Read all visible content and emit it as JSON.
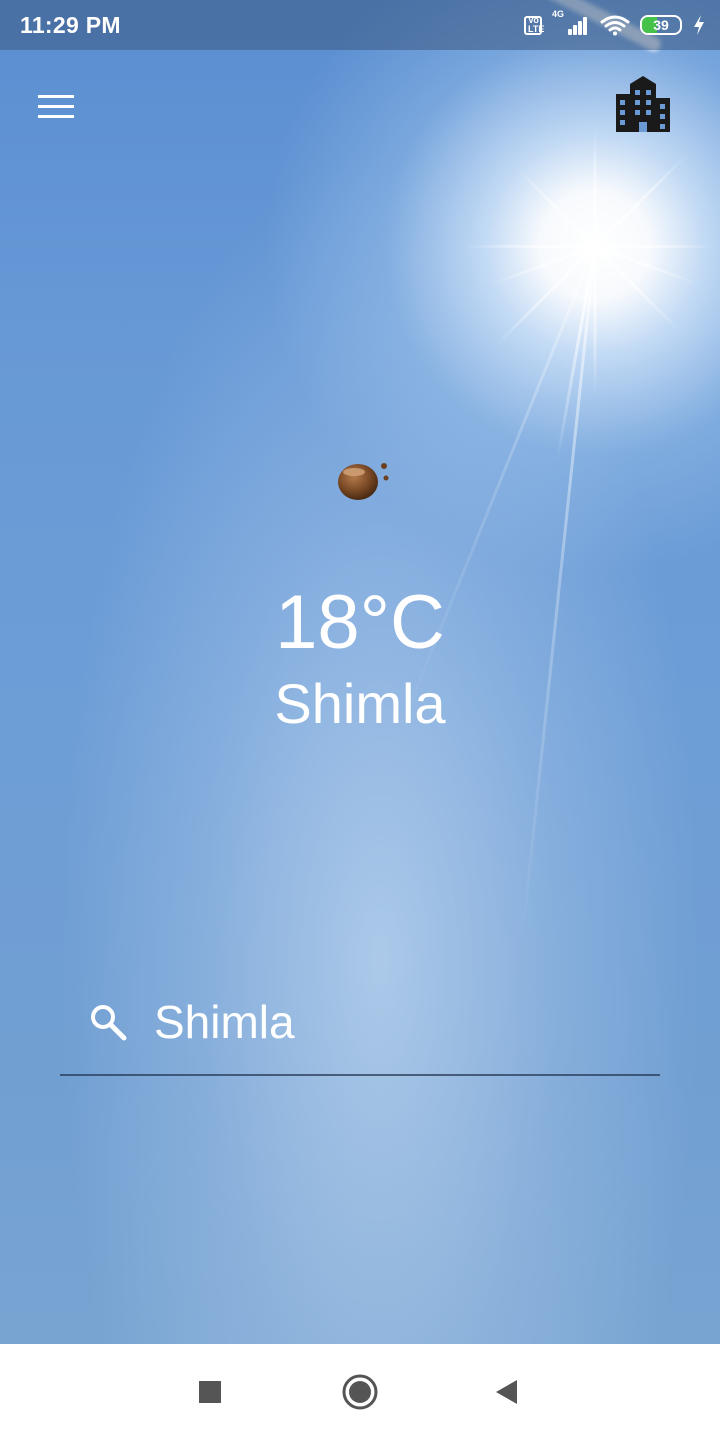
{
  "status_bar": {
    "time": "11:29 PM",
    "volte_top": "Vo",
    "volte_bottom": "LTE",
    "network": "4G",
    "battery": "39",
    "battery_color": "#46c24a"
  },
  "toolbar": {
    "menu_icon": "hamburger-menu-icon",
    "city_icon": "city-buildings-icon"
  },
  "weather": {
    "icon": "weather-condition-icon",
    "temperature": "18°C",
    "city": "Shimla"
  },
  "search": {
    "icon": "search-icon",
    "value": "Shimla"
  },
  "nav_bar": {
    "recents_icon": "square-recents-icon",
    "home_icon": "circle-home-icon",
    "back_icon": "triangle-back-icon"
  },
  "colors": {
    "sky": "#6a9bd5",
    "text": "#ffffff",
    "underline": "#3a4f6e"
  }
}
